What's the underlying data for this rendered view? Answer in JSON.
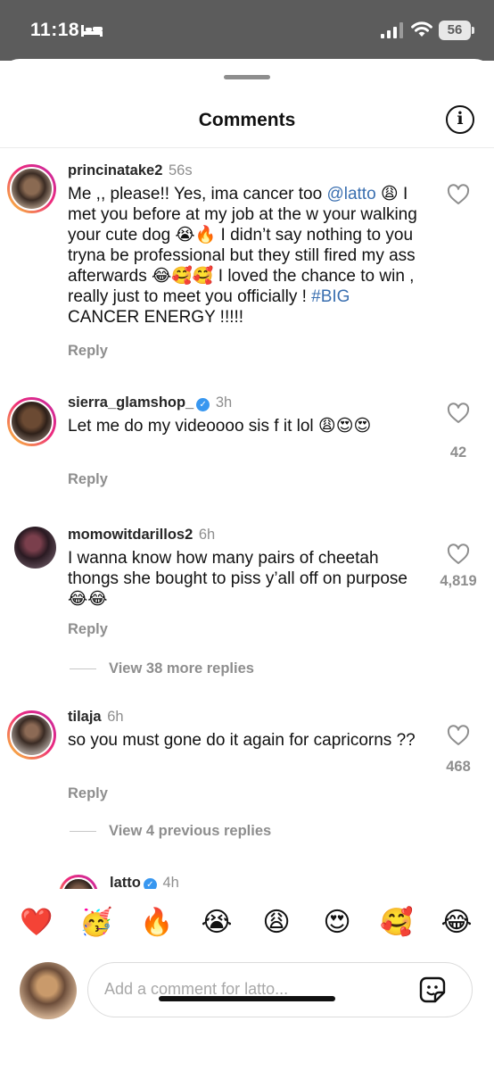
{
  "status_bar": {
    "time": "11:18",
    "battery": "56"
  },
  "sheet": {
    "title": "Comments"
  },
  "comments": [
    {
      "user": "princinatake2",
      "time": "56s",
      "verified": false,
      "segments": [
        {
          "t": "text",
          "v": "Me ,, please!! Yes,  ima cancer too "
        },
        {
          "t": "mention",
          "v": "@latto"
        },
        {
          "t": "text",
          "v": " 😩 I met you before at my job at the w your walking your cute dog 😭🔥 I didn’t say nothing to you tryna be professional but they still fired my ass afterwards 😂🥰🥰 I loved the chance to win , really just to meet you officially ! "
        },
        {
          "t": "hashtag",
          "v": "#BIG"
        },
        {
          "t": "text",
          "v": " CANCER ENERGY !!!!!"
        }
      ],
      "reply_label": "Reply",
      "likes": ""
    },
    {
      "user": "sierra_glamshop_",
      "time": "3h",
      "verified": true,
      "segments": [
        {
          "t": "text",
          "v": "Let me do my videoooo sis f it lol 😩😍😍"
        }
      ],
      "reply_label": "Reply",
      "likes": "42"
    },
    {
      "user": "momowitdarillos2",
      "time": "6h",
      "verified": false,
      "segments": [
        {
          "t": "text",
          "v": "I wanna know how many pairs of cheetah thongs she bought to piss y’all off on purpose😂😂"
        }
      ],
      "reply_label": "Reply",
      "likes": "4,819",
      "view_replies": "View 38 more replies"
    },
    {
      "user": "tilaja",
      "time": "6h",
      "verified": false,
      "segments": [
        {
          "t": "text",
          "v": "so you must gone do it again for capricorns ??"
        }
      ],
      "reply_label": "Reply",
      "likes": "468",
      "view_replies": "View 4 previous replies"
    },
    {
      "user": "latto",
      "time": "4h",
      "verified": true,
      "segments": [],
      "reply_label": "",
      "likes": ""
    }
  ],
  "reactions": [
    "❤️",
    "🥳",
    "🔥",
    "😭",
    "😩",
    "😍",
    "🥰",
    "😂"
  ],
  "composer": {
    "placeholder": "Add a comment for latto..."
  },
  "colors": {
    "accent_link": "#3a6fb0",
    "verified": "#3897f0",
    "muted": "#8e8e8e",
    "ring_start": "#f9ce34",
    "ring_end": "#c32aa3"
  },
  "icons": {
    "info": "info-icon",
    "heart": "heart-outline-icon",
    "sticker": "sticker-icon",
    "wifi": "wifi-icon",
    "signal": "cellular-signal-icon",
    "sleep": "bed-icon"
  }
}
